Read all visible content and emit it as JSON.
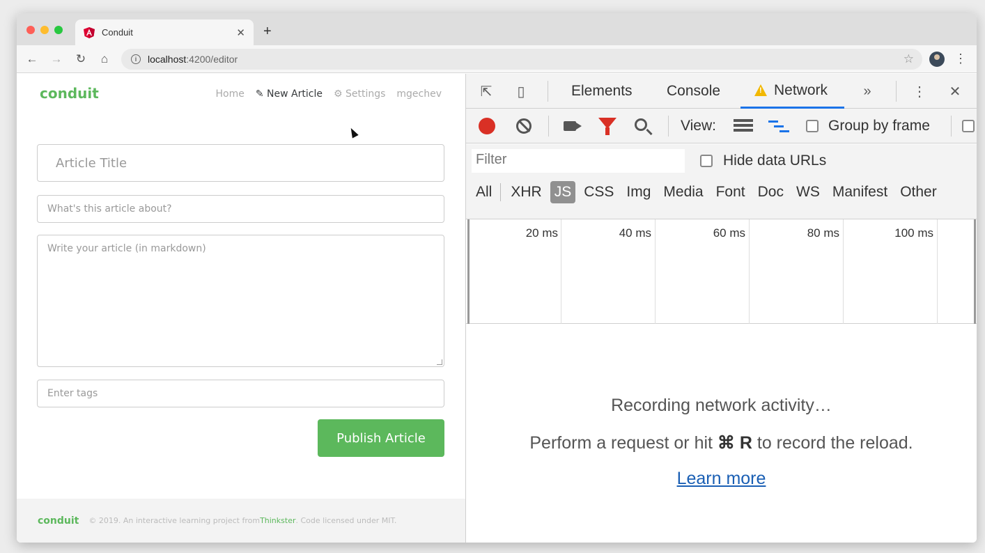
{
  "browser": {
    "tab_title": "Conduit",
    "url_host": "localhost",
    "url_rest": ":4200/editor"
  },
  "icons": {
    "favicon": "angular-icon",
    "back": "arrow-left-icon",
    "forward": "arrow-right-icon",
    "reload": "reload-icon",
    "home": "home-icon"
  },
  "app": {
    "brand": "conduit",
    "nav": {
      "home": "Home",
      "new_article": "New Article",
      "settings": "Settings",
      "user": "mgechev"
    },
    "editor": {
      "title_placeholder": "Article Title",
      "about_placeholder": "What's this article about?",
      "body_placeholder": "Write your article (in markdown)",
      "tags_placeholder": "Enter tags",
      "publish_label": "Publish Article"
    },
    "footer": {
      "brand": "conduit",
      "text_before": "© 2019. An interactive learning project from ",
      "link": "Thinkster",
      "text_after": ". Code licensed under MIT."
    }
  },
  "devtools": {
    "tabs": {
      "elements": "Elements",
      "console": "Console",
      "network": "Network"
    },
    "view_label": "View:",
    "group_by_frame": "Group by frame",
    "filter_placeholder": "Filter",
    "hide_data_urls": "Hide data URLs",
    "types": {
      "all": "All",
      "xhr": "XHR",
      "js": "JS",
      "css": "CSS",
      "img": "Img",
      "media": "Media",
      "font": "Font",
      "doc": "Doc",
      "ws": "WS",
      "manifest": "Manifest",
      "other": "Other"
    },
    "timeline": {
      "t20": "20 ms",
      "t40": "40 ms",
      "t60": "60 ms",
      "t80": "80 ms",
      "t100": "100 ms"
    },
    "recording": "Recording network activity…",
    "hint_before": "Perform a request or hit ",
    "hint_key": "⌘ R",
    "hint_after": " to record the reload.",
    "learn_more": "Learn more",
    "colors": {
      "record": "#d93025",
      "filter": "#d93025",
      "active_tab": "#1a73e8",
      "warning": "#f2b800"
    }
  }
}
